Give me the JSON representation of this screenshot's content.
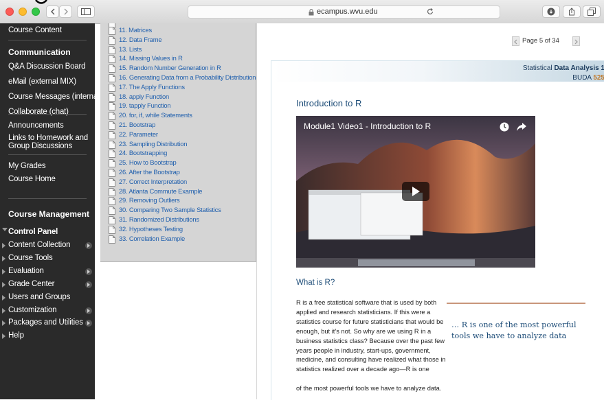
{
  "browser": {
    "url": "ecampus.wvu.edu"
  },
  "left_menu": {
    "top_item": "Course Content",
    "communication_header": "Communication",
    "communication_items": [
      "Q&A Discussion Board",
      "eMail (external MIX)",
      "Course Messages (internal)",
      "Collaborate (chat)"
    ],
    "announcements": "Announcements",
    "links_homework": "Links to Homework and Group Discussions",
    "my_grades": "My Grades",
    "course_home": "Course Home",
    "course_management_header": "Course Management",
    "control_panel": "Control Panel",
    "control_panel_items": [
      "Content Collection",
      "Course Tools",
      "Evaluation",
      "Grade Center",
      "Users and Groups",
      "Customization",
      "Packages and Utilities",
      "Help"
    ]
  },
  "toc": {
    "items": [
      "11. Matrices",
      "12. Data Frame",
      "13. Lists",
      "14. Missing Values in R",
      "15. Random Number Generation in R",
      "16. Generating Data from a Probability Distribution",
      "17. The Apply Functions",
      "18. apply Function",
      "19. tapply Function",
      "20. for, if, while Statements",
      "21. Bootstrap",
      "22. Parameter",
      "23. Sampling Distribution",
      "24. Bootstrapping",
      "25. How to Bootstrap",
      "26. After the Bootstrap",
      "27. Correct Interpretation",
      "28. Atlanta Commute Example",
      "29. Removing Outliers",
      "30. Comparing Two Sample Statistics",
      "31. Randomized Distributions",
      "32. Hypotheses Testing",
      "33. Correlation Example"
    ]
  },
  "pager": {
    "label": "Page 5 of 34"
  },
  "slide": {
    "banner_prefix": "Statistical ",
    "banner_bold": "Data Analysis 1",
    "course_prefix": "BUDA ",
    "course_number": "525",
    "title": "Introduction to R",
    "video_title": "Module1 Video1 - Introduction to R",
    "what_heading": "What is R?",
    "body": "R is a free statistical software that is used by both applied and research statisticians. If this were a statistics course for future statisticians that would be enough, but it’s not. So why are we using R in a business statistics class? Because over the past few years people in industry, start-ups, government, medicine, and consulting have realized what those in statistics realized over a decade ago—R is one",
    "body_last": "of the most powerful tools we have to analyze data.",
    "quote": "… R is one of the most powerful tools we have to analyze data"
  },
  "colors": {
    "menu_bg": "#2a2a2a",
    "toc_bg": "#d5d5d5",
    "link": "#1f5fad",
    "heading": "#1e4d78",
    "quote_rule": "#c8967a"
  }
}
